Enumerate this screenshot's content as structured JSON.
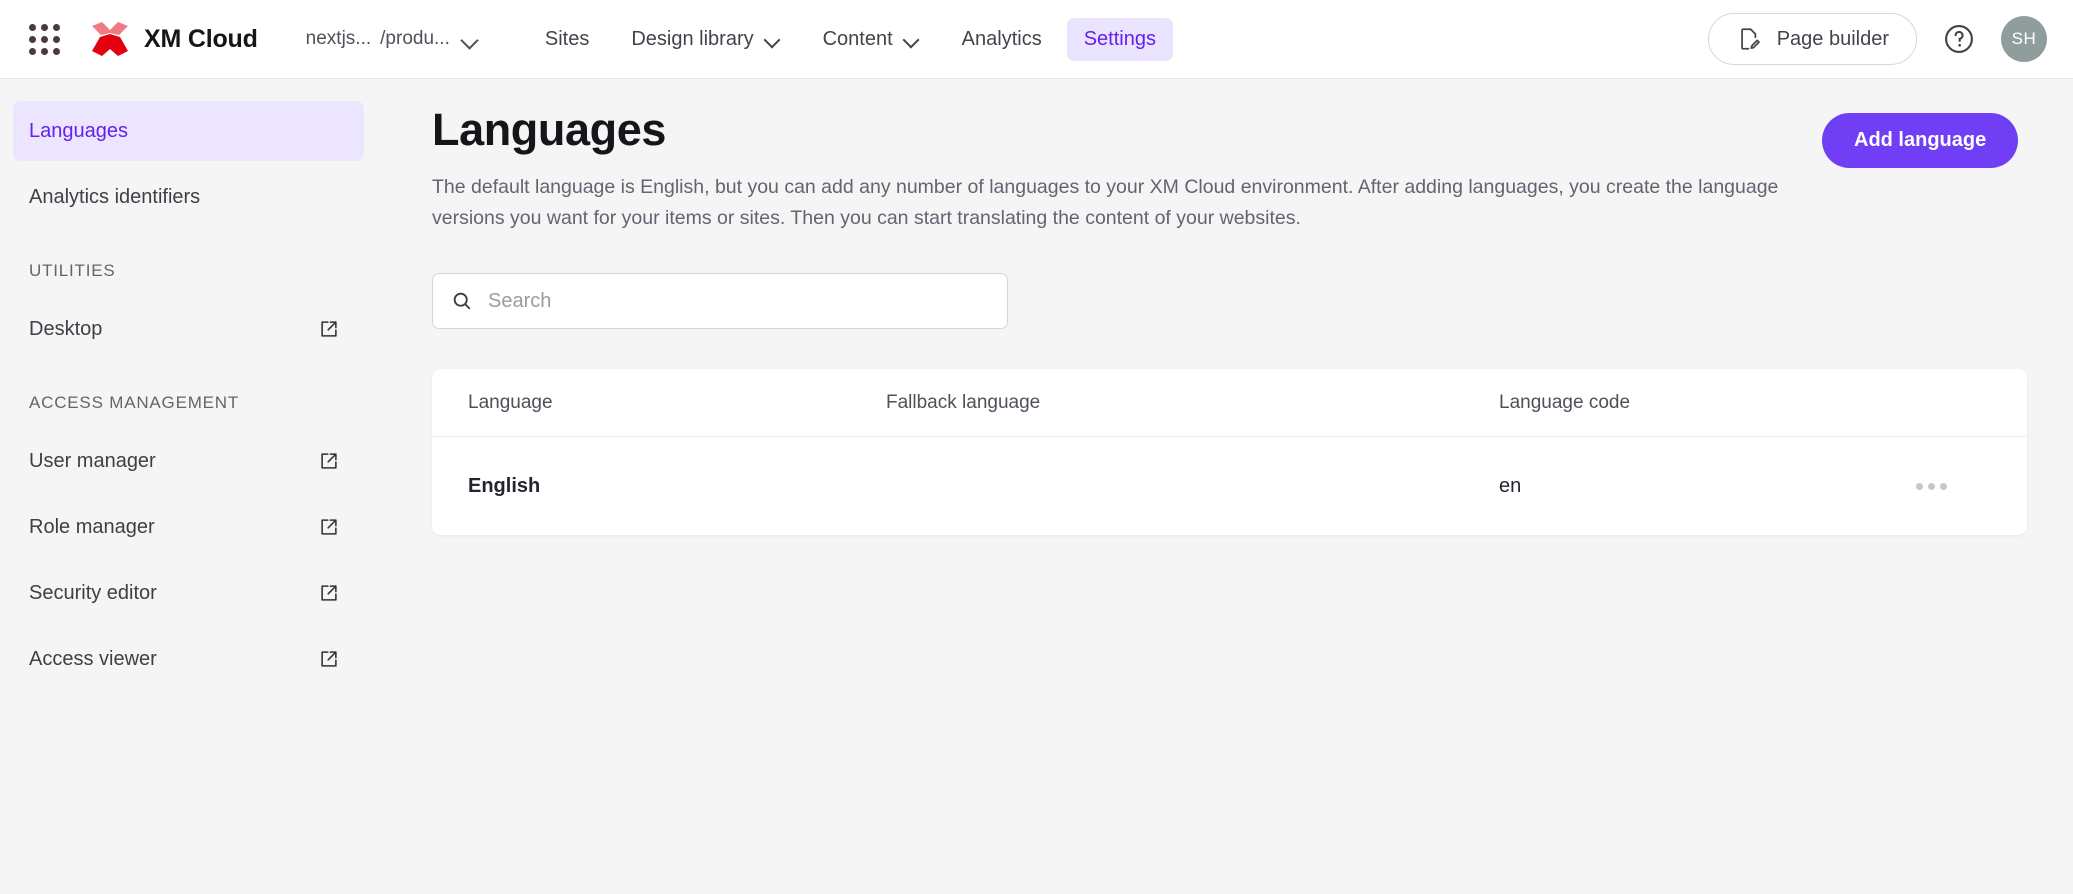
{
  "header": {
    "apps_icon": "apps-grid-icon",
    "brand": "XM Cloud",
    "environment": {
      "site": "nextjs...",
      "path": "/produ..."
    },
    "nav": [
      {
        "label": "Sites",
        "has_menu": false,
        "active": false
      },
      {
        "label": "Design library",
        "has_menu": true,
        "active": false
      },
      {
        "label": "Content",
        "has_menu": true,
        "active": false
      },
      {
        "label": "Analytics",
        "has_menu": false,
        "active": false
      },
      {
        "label": "Settings",
        "has_menu": false,
        "active": true
      }
    ],
    "page_builder_label": "Page builder",
    "help_icon": "help-circle-icon",
    "avatar_initials": "SH",
    "accent_color": "#6320ee",
    "active_nav_bg": "#ebe4ff"
  },
  "sidebar": {
    "items": [
      {
        "label": "Languages",
        "active": true,
        "external": false
      },
      {
        "label": "Analytics identifiers",
        "active": false,
        "external": false
      }
    ],
    "groups": [
      {
        "title": "UTILITIES",
        "items": [
          {
            "label": "Desktop",
            "active": false,
            "external": true
          }
        ]
      },
      {
        "title": "ACCESS MANAGEMENT",
        "items": [
          {
            "label": "User manager",
            "active": false,
            "external": true
          },
          {
            "label": "Role manager",
            "active": false,
            "external": true
          },
          {
            "label": "Security editor",
            "active": false,
            "external": true
          },
          {
            "label": "Access viewer",
            "active": false,
            "external": true
          }
        ]
      }
    ]
  },
  "main": {
    "title": "Languages",
    "description": "The default language is English, but you can add any number of languages to your XM Cloud environment. After adding languages, you create the language versions you want for your items or sites. Then you can start translating the content of your websites.",
    "add_button": "Add language",
    "add_button_color": "#6f3ef5",
    "search": {
      "value": "",
      "placeholder": "Search",
      "icon": "search-icon"
    },
    "table": {
      "columns": [
        "Language",
        "Fallback language",
        "Language code"
      ],
      "rows": [
        {
          "language": "English",
          "fallback": "",
          "code": "en",
          "menu_icon": "more-horizontal-icon"
        }
      ]
    }
  }
}
